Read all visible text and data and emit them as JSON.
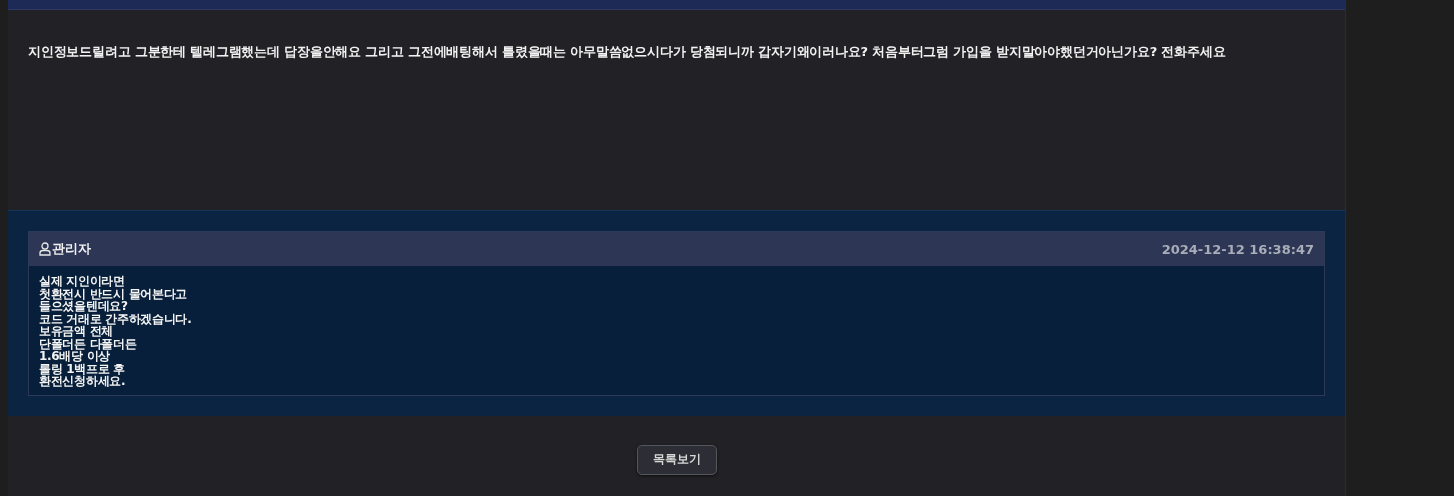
{
  "post": {
    "body": "지인정보드릴려고 그분한테 텔레그램했는데 답장을안해요 그리고 그전에배팅해서 틀렸을때는 아무말씀없으시다가 당첨되니까 갑자기왜이러나요? 처음부터그럼 가입을 받지말아야했던거아닌가요? 전화주세요"
  },
  "comments": [
    {
      "author": "관리자",
      "date": "2024-12-12 16:38:47",
      "lines": [
        "실제 지인이라면",
        "첫환전시 반드시 물어본다고",
        "들으셨을텐데요?",
        "코드 거래로 간주하겠습니다.",
        "보유금액 전체",
        "단폴더든 다폴더든",
        "1.6배당 이상",
        "롤링 1백프로 후",
        "환전신청하세요."
      ]
    }
  ],
  "list_button": "목록보기"
}
